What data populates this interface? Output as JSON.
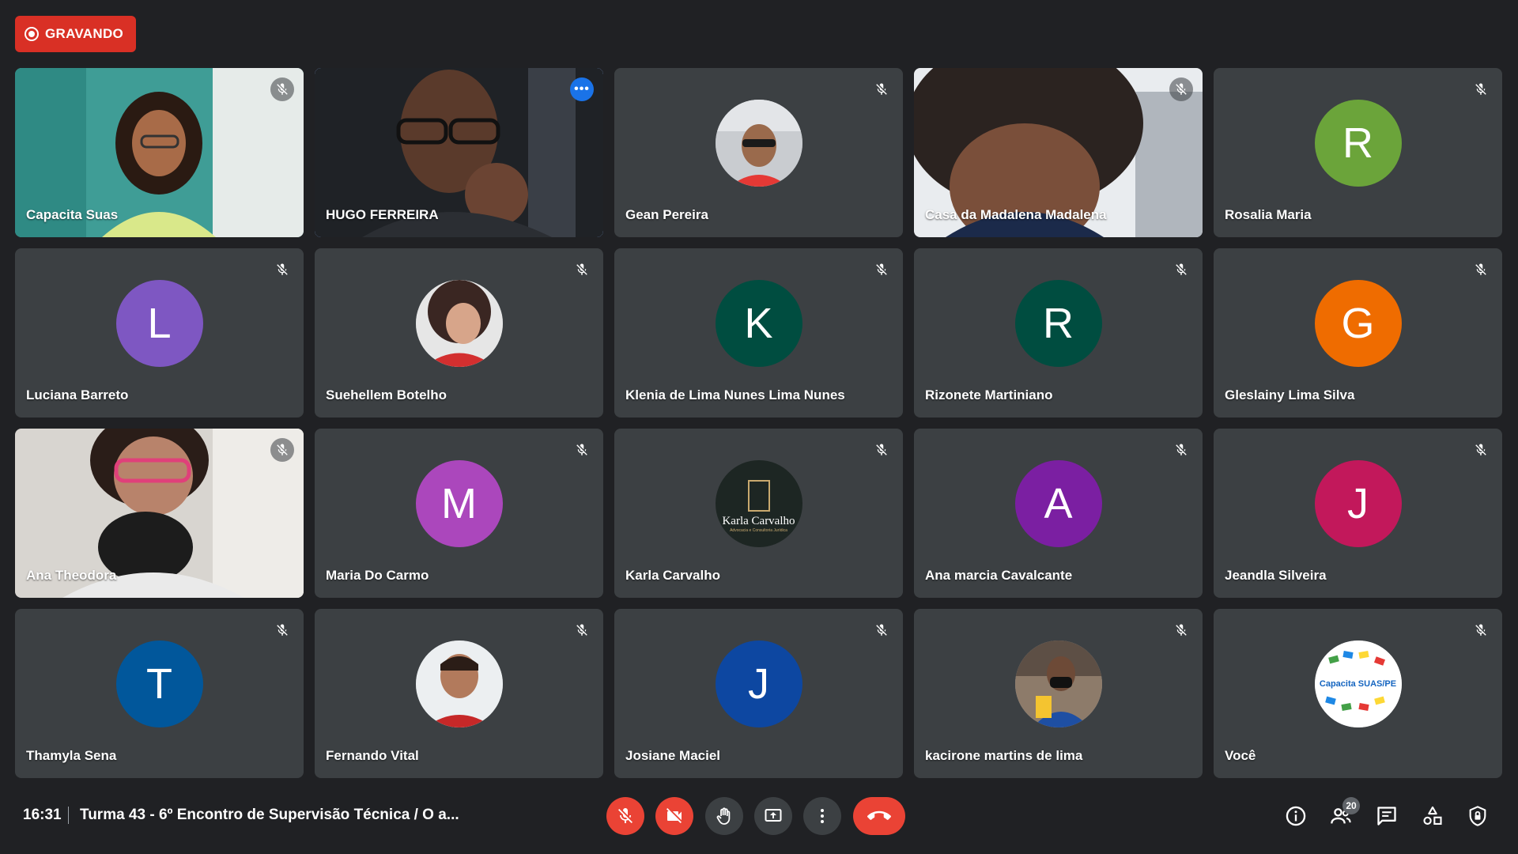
{
  "recording": {
    "label": "GRAVANDO"
  },
  "tiles": [
    {
      "name": "Capacita Suas",
      "type": "video"
    },
    {
      "name": "HUGO FERREIRA",
      "type": "video"
    },
    {
      "name": "Gean Pereira",
      "type": "photo"
    },
    {
      "name": "Casa da Madalena Madalena",
      "type": "video"
    },
    {
      "name": "Rosalia Maria",
      "type": "initial",
      "initial": "R",
      "color": "#6ba43a"
    },
    {
      "name": "Luciana Barreto",
      "type": "initial",
      "initial": "L",
      "color": "#7e57c2"
    },
    {
      "name": "Suehellem Botelho",
      "type": "photo"
    },
    {
      "name": "Klenia de Lima Nunes Lima Nunes",
      "type": "initial",
      "initial": "K",
      "color": "#004d40"
    },
    {
      "name": "Rizonete Martiniano",
      "type": "initial",
      "initial": "R",
      "color": "#004d40"
    },
    {
      "name": "Gleslainy Lima Silva",
      "type": "initial",
      "initial": "G",
      "color": "#ef6c00"
    },
    {
      "name": "Ana Theodora",
      "type": "video"
    },
    {
      "name": "Maria Do Carmo",
      "type": "initial",
      "initial": "M",
      "color": "#ab47bc"
    },
    {
      "name": "Karla Carvalho",
      "type": "logo",
      "logo_text": "Karla Carvalho",
      "logo_sub": "Advocacia e Consultoria Jurídica"
    },
    {
      "name": "Ana marcia Cavalcante",
      "type": "initial",
      "initial": "A",
      "color": "#7b1fa2"
    },
    {
      "name": "Jeandla Silveira",
      "type": "initial",
      "initial": "J",
      "color": "#c2185b"
    },
    {
      "name": "Thamyla Sena",
      "type": "initial",
      "initial": "T",
      "color": "#01579b"
    },
    {
      "name": "Fernando Vital",
      "type": "photo"
    },
    {
      "name": "Josiane Maciel",
      "type": "initial",
      "initial": "J",
      "color": "#0d47a1"
    },
    {
      "name": "kacirone martins de lima",
      "type": "photo"
    },
    {
      "name": "Você",
      "type": "logo",
      "logo_text": "Capacita SUAS/PE"
    }
  ],
  "bottom_bar": {
    "time": "16:31",
    "meeting_title": "Turma 43 - 6º Encontro de Supervisão Técnica / O a...",
    "participants_count": "20"
  },
  "icons": {
    "recording": "record-icon",
    "mic_off": "mic-off-icon",
    "camera_off": "camera-off-icon",
    "raise_hand": "hand-icon",
    "present": "present-screen-icon",
    "more": "more-vertical-icon",
    "hangup": "phone-hangup-icon",
    "info": "info-icon",
    "people": "people-icon",
    "chat": "chat-icon",
    "activities": "activities-icon",
    "host_controls": "shield-lock-icon"
  }
}
